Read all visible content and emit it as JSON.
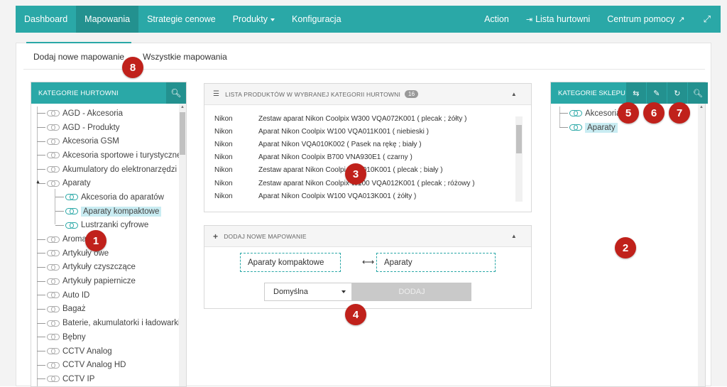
{
  "navbar": {
    "left_items": [
      {
        "label": "Dashboard",
        "active": false,
        "has_caret": false
      },
      {
        "label": "Mapowania",
        "active": true,
        "has_caret": false
      },
      {
        "label": "Strategie cenowe",
        "active": false,
        "has_caret": false
      },
      {
        "label": "Produkty",
        "active": false,
        "has_caret": true
      },
      {
        "label": "Konfiguracja",
        "active": false,
        "has_caret": false
      }
    ],
    "action": "Action",
    "wholesalers": "Lista hurtowni",
    "help": "Centrum pomocy"
  },
  "tabs": {
    "add_mapping": "Dodaj nowe mapowanie",
    "all_mappings": "Wszystkie mapowania"
  },
  "left_panel": {
    "title": "KATEGORIE HURTOWNI",
    "items": [
      {
        "label": "AGD - Akcesoria",
        "child": false,
        "selected": false,
        "teal": false
      },
      {
        "label": "AGD - Produkty",
        "child": false,
        "selected": false,
        "teal": false
      },
      {
        "label": "Akcesoria GSM",
        "child": false,
        "selected": false,
        "teal": false
      },
      {
        "label": "Akcesoria sportowe i turystyczne",
        "child": false,
        "selected": false,
        "teal": false
      },
      {
        "label": "Akumulatory do elektronarzędzi",
        "child": false,
        "selected": false,
        "teal": false
      },
      {
        "label": "Aparaty",
        "child": false,
        "selected": false,
        "teal": false,
        "expanded": true
      },
      {
        "label": "Akcesoria do aparatów",
        "child": true,
        "selected": false,
        "teal": true
      },
      {
        "label": "Aparaty kompaktowe",
        "child": true,
        "selected": true,
        "teal": true
      },
      {
        "label": "Lustrzanki cyfrowe",
        "child": true,
        "selected": false,
        "teal": true
      },
      {
        "label": "Aromat",
        "child": false,
        "selected": false,
        "teal": false
      },
      {
        "label": "Artykuły owe",
        "child": false,
        "selected": false,
        "teal": false
      },
      {
        "label": "Artykuły czyszczące",
        "child": false,
        "selected": false,
        "teal": false
      },
      {
        "label": "Artykuły papiernicze",
        "child": false,
        "selected": false,
        "teal": false
      },
      {
        "label": "Auto ID",
        "child": false,
        "selected": false,
        "teal": false
      },
      {
        "label": "Bagaż",
        "child": false,
        "selected": false,
        "teal": false
      },
      {
        "label": "Baterie, akumulatorki i ładowarki",
        "child": false,
        "selected": false,
        "teal": false
      },
      {
        "label": "Bębny",
        "child": false,
        "selected": false,
        "teal": false
      },
      {
        "label": "CCTV Analog",
        "child": false,
        "selected": false,
        "teal": false
      },
      {
        "label": "CCTV Analog HD",
        "child": false,
        "selected": false,
        "teal": false
      },
      {
        "label": "CCTV IP",
        "child": false,
        "selected": false,
        "teal": false
      }
    ]
  },
  "products_panel": {
    "title": "LISTA PRODUKTÓW W WYBRANEJ KATEGORII HURTOWNI",
    "count": "16",
    "rows": [
      {
        "brand": "Nikon",
        "name": "Zestaw aparat Nikon Coolpix W300 VQA072K001 ( plecak ; żółty )"
      },
      {
        "brand": "Nikon",
        "name": "Aparat Nikon Coolpix W100 VQA011K001 ( niebieski )"
      },
      {
        "brand": "Nikon",
        "name": "Aparat Nikon VQA010K002 ( Pasek na rękę ; biały )"
      },
      {
        "brand": "Nikon",
        "name": "Aparat Nikon Coolpix B700 VNA930E1 ( czarny )"
      },
      {
        "brand": "Nikon",
        "name": "Zestaw aparat Nikon Coolpi VQA010K001 ( plecak ; biały )"
      },
      {
        "brand": "Nikon",
        "name": "Zestaw aparat Nikon Coolpix W100 VQA012K001 ( plecak ; różowy )"
      },
      {
        "brand": "Nikon",
        "name": "Aparat Nikon Coolpix W100 VQA013K001 ( żółty )"
      }
    ]
  },
  "add_panel": {
    "title": "DODAJ NOWE MAPOWANIE",
    "source": "Aparaty kompaktowe",
    "target": "Aparaty",
    "strategy": "Domyślna",
    "button": "DODAJ"
  },
  "right_panel": {
    "title": "KATEGORIE SKLEPU",
    "items": [
      {
        "label": "Akcesoria",
        "selected": false
      },
      {
        "label": "Aparaty",
        "selected": true
      }
    ]
  },
  "markers": [
    "1",
    "2",
    "3",
    "4",
    "5",
    "6",
    "7",
    "8"
  ],
  "colors": {
    "accent": "#2aa8a7",
    "accent_dark": "#23918f",
    "marker": "#c0211b",
    "selected_bg": "#c9ecf2"
  }
}
